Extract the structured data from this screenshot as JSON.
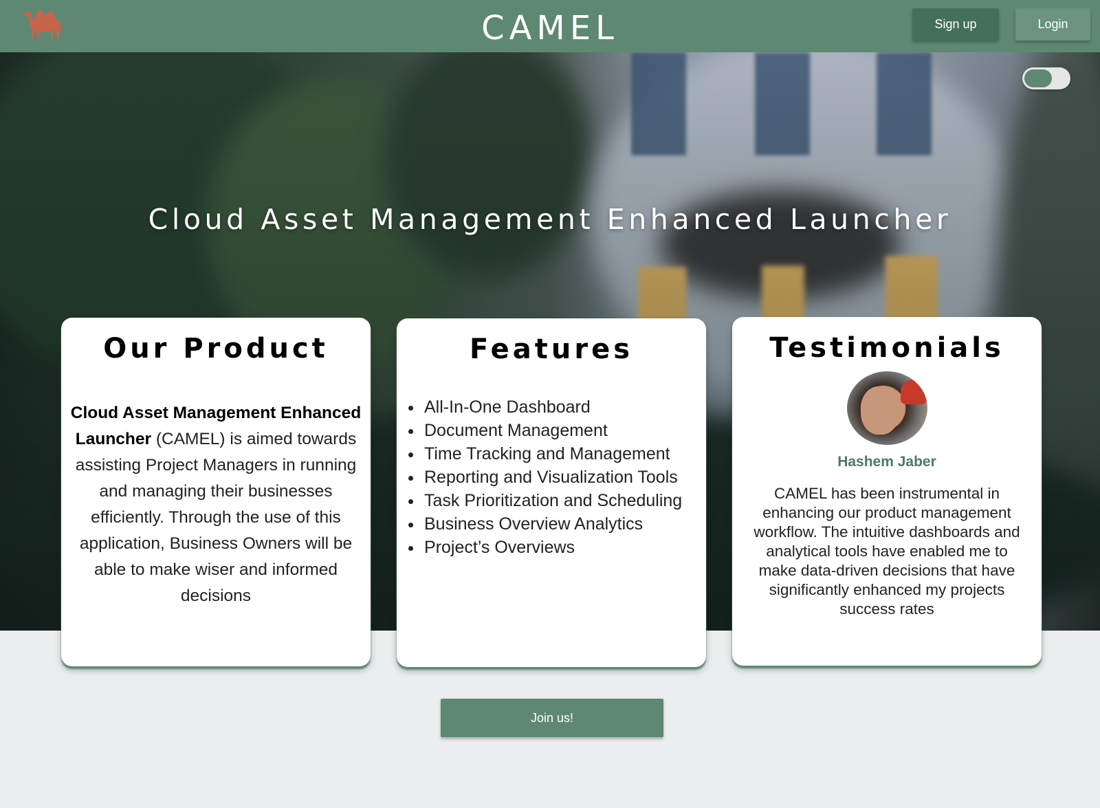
{
  "header": {
    "brand": "CAMEL",
    "logo_icon": "camel-icon",
    "signup_label": "Sign up",
    "login_label": "Login",
    "colors": {
      "bar": "#5e8872",
      "signup": "#44705a",
      "login": "#6b9380"
    }
  },
  "hero": {
    "title": "Cloud Asset Management Enhanced Launcher",
    "theme_toggle": {
      "state": "on"
    }
  },
  "product": {
    "title": "Our Product",
    "bold_name": "Cloud Asset Management Enhanced Launcher",
    "description": " (CAMEL) is aimed towards assisting Project Managers in running and managing their businesses efficiently. Through the use of this application, Business Owners will be able to make wiser and informed decisions"
  },
  "features": {
    "title": "Features",
    "items": [
      "All-In-One Dashboard",
      "Document Management",
      "Time Tracking and Management",
      "Reporting and Visualization Tools",
      "Task Prioritization and Scheduling",
      "Business Overview Analytics",
      "Project’s Overviews"
    ]
  },
  "testimonials": {
    "title": "Testimonials",
    "name": "Hashem Jaber",
    "quote": "CAMEL has been instrumental in enhancing our product management workflow. The intuitive dashboards and analytical tools have enabled me to make data-driven decisions that have significantly enhanced my projects success rates"
  },
  "cta": {
    "label": "Join us!"
  }
}
